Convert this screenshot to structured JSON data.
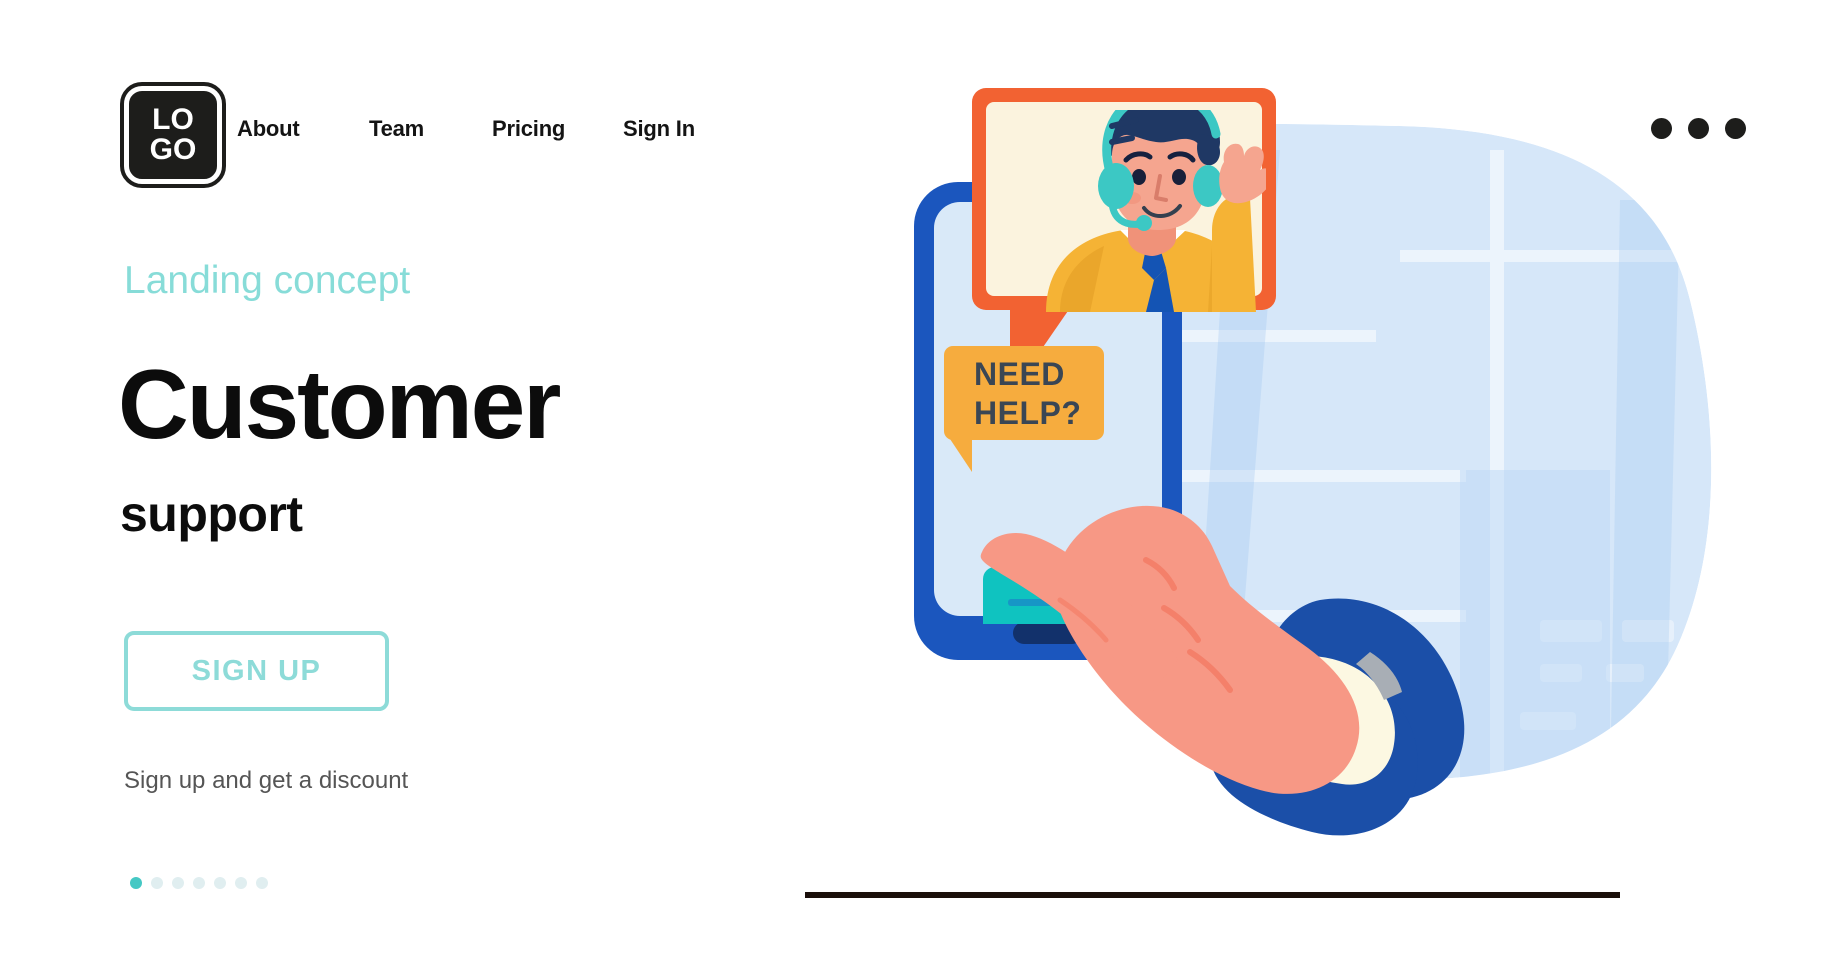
{
  "brand": {
    "logo_line1": "LO",
    "logo_line2": "GO"
  },
  "nav": {
    "items": [
      {
        "label": "About"
      },
      {
        "label": "Team"
      },
      {
        "label": "Pricing"
      },
      {
        "label": "Sign In"
      }
    ],
    "overflow_menu": "more-options"
  },
  "hero": {
    "eyebrow": "Landing concept",
    "headline": "Customer",
    "subheadline": "support",
    "cta_label": "SIGN UP",
    "cta_caption": "Sign up and get a discount",
    "carousel": {
      "total_dots": 7,
      "active_index": 0
    }
  },
  "illustration": {
    "name": "customer-support-phone-illustration",
    "video_call_caption": "",
    "chat_bubble_line1": "NEED",
    "chat_bubble_line2": "HELP?",
    "agent": {
      "label": "support-agent-with-headset",
      "shirt_color": "#F5B335",
      "tie_color": "#1454B4",
      "hair_color": "#1F3864",
      "headset_color": "#3CC8C4",
      "skin_color": "#F5A58F"
    },
    "phone": {
      "frame_color": "#1B56BE",
      "screen_color": "#D9E9F8",
      "home_button_color": "#12316B",
      "message_card_color": "#0FC3C0"
    },
    "bubble_border_color": "#F26232",
    "bubble_fill_color": "#FBF3DE",
    "help_bubble_color": "#F6AC3E",
    "help_text_color": "#3A4654",
    "hand_color": "#F79885",
    "cuff_color": "#FCF8E2",
    "sleeve_color": "#1B4FA8",
    "background_blob_color": "#D6E7F9",
    "ground_line_color": "#1A0F0A"
  },
  "colors": {
    "accent_teal": "#8DDBD8",
    "text_dark": "#0C0C0C",
    "text_muted": "#555555",
    "logo_black": "#1D1D1B"
  }
}
